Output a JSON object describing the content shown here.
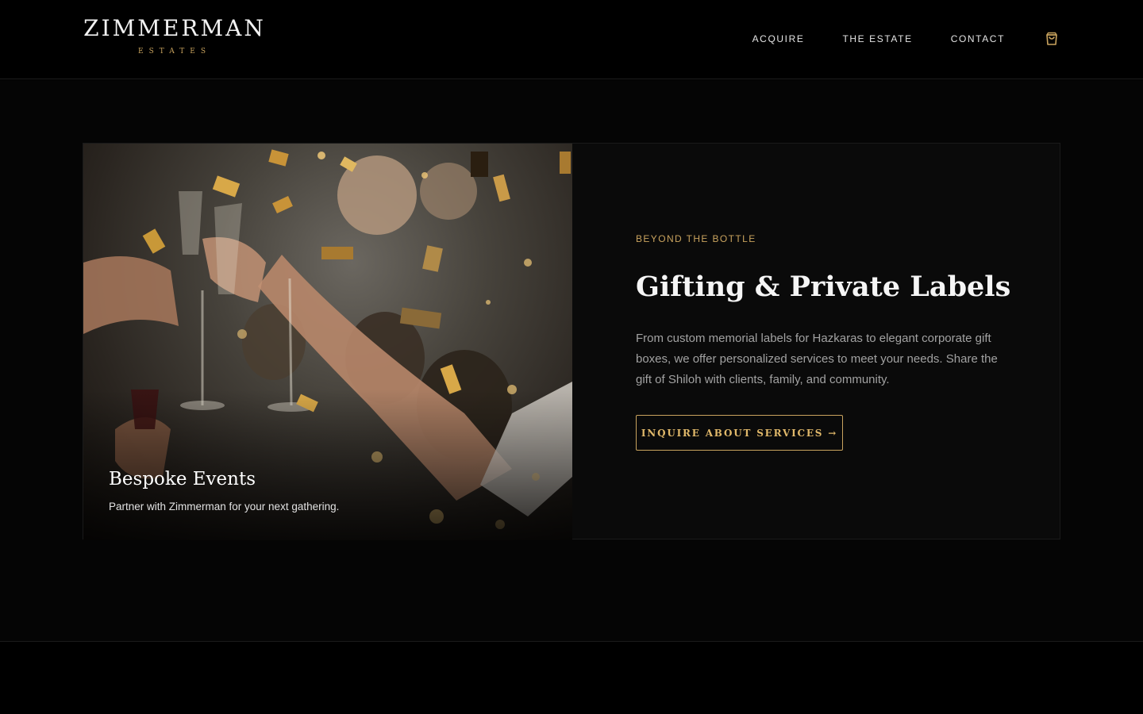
{
  "header": {
    "brand": "ZIMMERMAN",
    "brand_sub": "ESTATES",
    "nav": [
      {
        "label": "ACQUIRE"
      },
      {
        "label": "THE ESTATE"
      },
      {
        "label": "CONTACT"
      }
    ],
    "cart_icon": "shopping-bag-icon"
  },
  "feature": {
    "image": {
      "title": "Bespoke Events",
      "subtitle": "Partner with Zimmerman for your next gathering."
    },
    "eyebrow": "BEYOND THE BOTTLE",
    "headline": "Gifting & Private Labels",
    "body": "From custom memorial labels for Hazkaras to elegant corporate gift boxes, we offer personalized services to meet your needs. Share the gift of Shiloh with clients, family, and community.",
    "cta_label": "INQUIRE ABOUT SERVICES →"
  },
  "colors": {
    "accent": "#c9a35e",
    "background": "#050505",
    "card": "#0a0a0a"
  }
}
